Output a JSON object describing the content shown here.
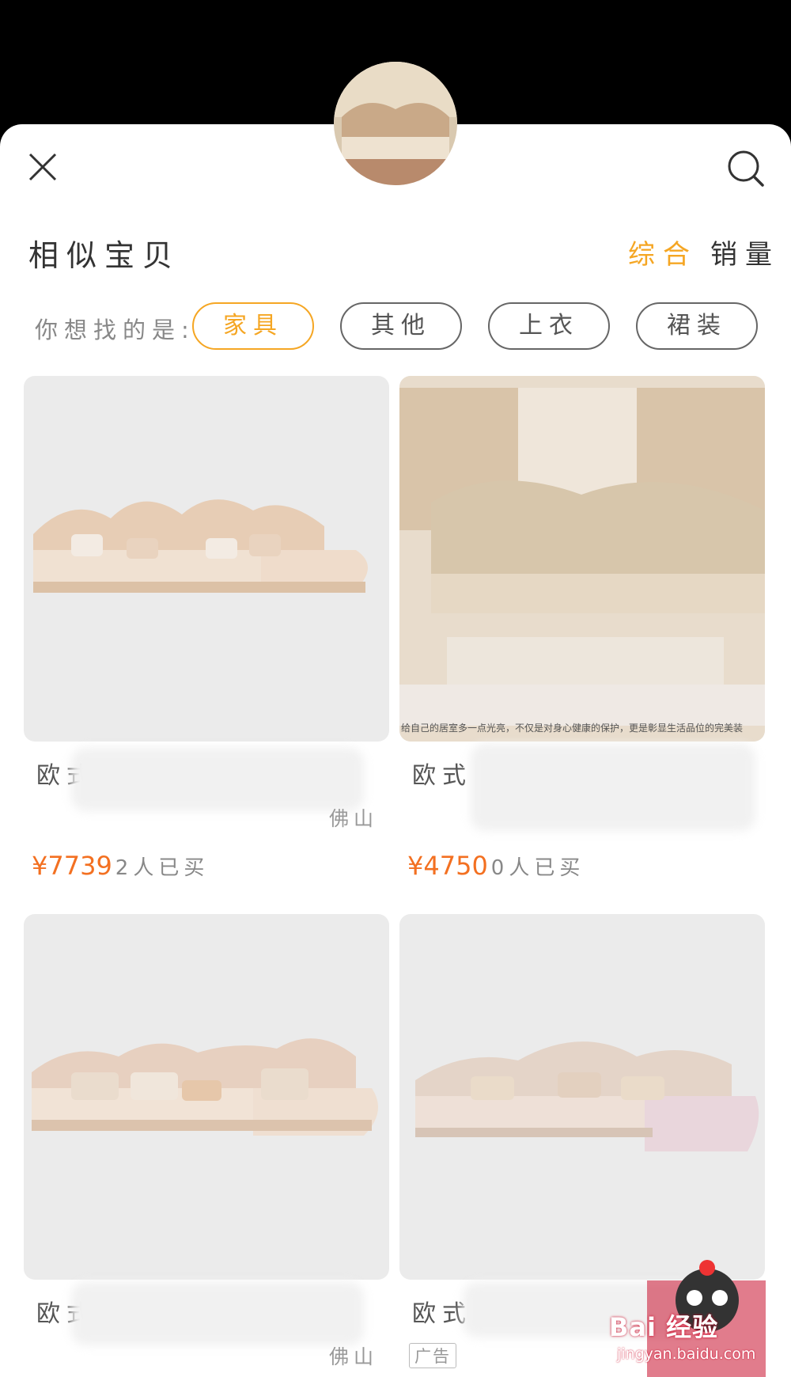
{
  "header": {
    "close_icon": "close-icon",
    "search_icon": "search-icon",
    "title": "相似宝贝",
    "sort_options": [
      "综合",
      "销量"
    ],
    "active_sort": "综合",
    "accent_color": "#f5a623"
  },
  "filter": {
    "hint": "你想找的是:",
    "chips": [
      "家具",
      "其他",
      "上衣",
      "裙装"
    ],
    "active_chip": "家具"
  },
  "products": [
    {
      "title": "欧式",
      "location": "佛山",
      "price": "¥7739",
      "sold": "2人已买"
    },
    {
      "title": "欧式 石",
      "location": "",
      "price": "¥4750",
      "sold": "0人已买",
      "image_caption": "给自己的居室多一点光亮，不仅是对身心健康的保护，更是彰显生活品位的完美装"
    },
    {
      "title": "欧式",
      "location": "佛山"
    },
    {
      "title": "欧式",
      "badge": "广告"
    }
  ],
  "watermark": {
    "brand": "Bai 经验",
    "url": "jingyan.baidu.com"
  },
  "colors": {
    "price": "#f37021",
    "image_bg": "#ebebeb"
  }
}
